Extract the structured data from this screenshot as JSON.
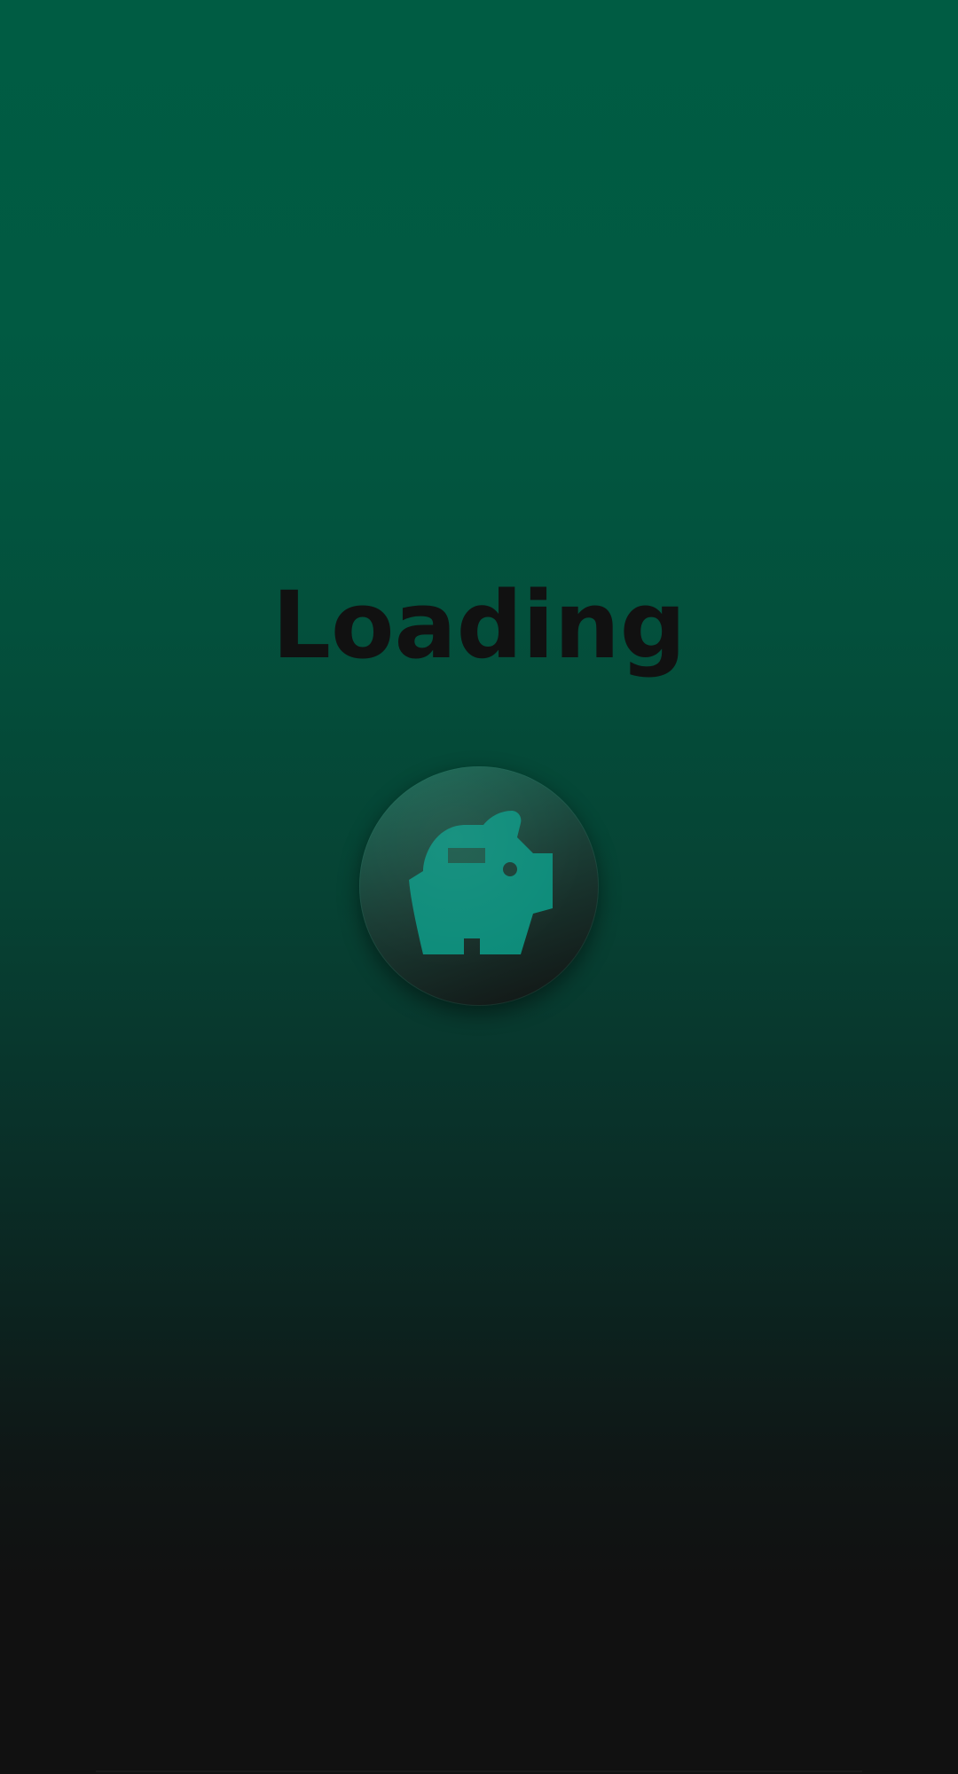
{
  "screen": {
    "title": "Loading",
    "icon": "piggy-bank-icon",
    "colors": {
      "background_top": "#005c43",
      "background_bottom": "#111111",
      "title_text": "#111111",
      "icon_fill": "#0d8c7a"
    }
  }
}
